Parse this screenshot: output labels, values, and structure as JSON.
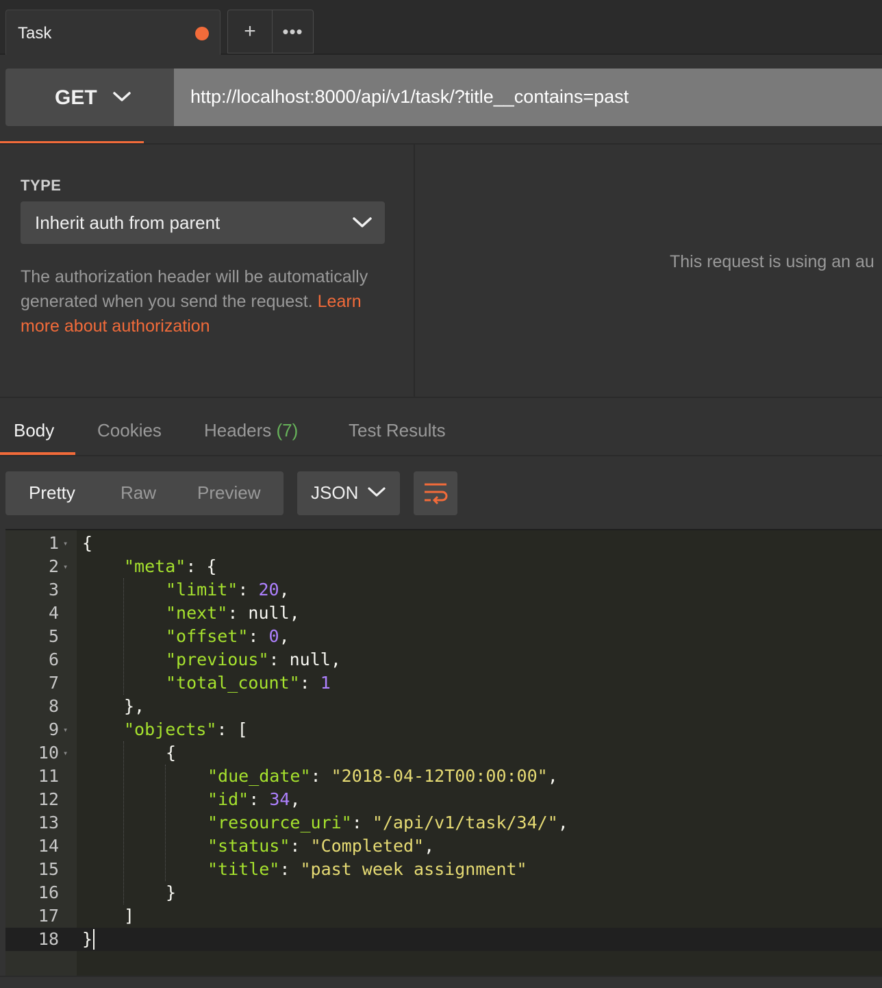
{
  "tabs": {
    "active_tab": "Task",
    "new_tab": "+",
    "more": "•••"
  },
  "request": {
    "method": "GET",
    "url": "http://localhost:8000/api/v1/task/?title__contains=past"
  },
  "auth": {
    "type_label": "TYPE",
    "type_value": "Inherit auth from parent",
    "description": "The authorization header will be automatically generated when you send the request. ",
    "link_text": "Learn more about authorization",
    "right_text": "This request is using an au"
  },
  "response_tabs": {
    "body": "Body",
    "cookies": "Cookies",
    "headers": "Headers",
    "headers_count": "(7)",
    "test_results": "Test Results"
  },
  "body_toolbar": {
    "pretty": "Pretty",
    "raw": "Raw",
    "preview": "Preview",
    "format": "JSON"
  },
  "editor": {
    "line_numbers": [
      "1",
      "2",
      "3",
      "4",
      "5",
      "6",
      "7",
      "8",
      "9",
      "10",
      "11",
      "12",
      "13",
      "14",
      "15",
      "16",
      "17",
      "18"
    ],
    "active_line": 18,
    "lines": [
      {
        "indent": 0,
        "tokens": [
          [
            "p",
            "{"
          ]
        ]
      },
      {
        "indent": 1,
        "tokens": [
          [
            "k",
            "\"meta\""
          ],
          [
            "p",
            ": {"
          ]
        ]
      },
      {
        "indent": 2,
        "tokens": [
          [
            "k",
            "\"limit\""
          ],
          [
            "p",
            ": "
          ],
          [
            "n",
            "20"
          ],
          [
            "p",
            ","
          ]
        ]
      },
      {
        "indent": 2,
        "tokens": [
          [
            "k",
            "\"next\""
          ],
          [
            "p",
            ": null,"
          ]
        ]
      },
      {
        "indent": 2,
        "tokens": [
          [
            "k",
            "\"offset\""
          ],
          [
            "p",
            ": "
          ],
          [
            "n",
            "0"
          ],
          [
            "p",
            ","
          ]
        ]
      },
      {
        "indent": 2,
        "tokens": [
          [
            "k",
            "\"previous\""
          ],
          [
            "p",
            ": null,"
          ]
        ]
      },
      {
        "indent": 2,
        "tokens": [
          [
            "k",
            "\"total_count\""
          ],
          [
            "p",
            ": "
          ],
          [
            "n",
            "1"
          ]
        ]
      },
      {
        "indent": 1,
        "tokens": [
          [
            "p",
            "},"
          ]
        ]
      },
      {
        "indent": 1,
        "tokens": [
          [
            "k",
            "\"objects\""
          ],
          [
            "p",
            ": ["
          ]
        ]
      },
      {
        "indent": 2,
        "tokens": [
          [
            "p",
            "{"
          ]
        ]
      },
      {
        "indent": 3,
        "tokens": [
          [
            "k",
            "\"due_date\""
          ],
          [
            "p",
            ": "
          ],
          [
            "s",
            "\"2018-04-12T00:00:00\""
          ],
          [
            "p",
            ","
          ]
        ]
      },
      {
        "indent": 3,
        "tokens": [
          [
            "k",
            "\"id\""
          ],
          [
            "p",
            ": "
          ],
          [
            "n",
            "34"
          ],
          [
            "p",
            ","
          ]
        ]
      },
      {
        "indent": 3,
        "tokens": [
          [
            "k",
            "\"resource_uri\""
          ],
          [
            "p",
            ": "
          ],
          [
            "s",
            "\"/api/v1/task/34/\""
          ],
          [
            "p",
            ","
          ]
        ]
      },
      {
        "indent": 3,
        "tokens": [
          [
            "k",
            "\"status\""
          ],
          [
            "p",
            ": "
          ],
          [
            "s",
            "\"Completed\""
          ],
          [
            "p",
            ","
          ]
        ]
      },
      {
        "indent": 3,
        "tokens": [
          [
            "k",
            "\"title\""
          ],
          [
            "p",
            ": "
          ],
          [
            "s",
            "\"past week assignment\""
          ]
        ]
      },
      {
        "indent": 2,
        "tokens": [
          [
            "p",
            "}"
          ]
        ]
      },
      {
        "indent": 1,
        "tokens": [
          [
            "p",
            "]"
          ]
        ]
      },
      {
        "indent": 0,
        "tokens": [
          [
            "p",
            "}"
          ]
        ]
      }
    ],
    "foldable_lines": [
      1,
      2,
      9,
      10
    ]
  },
  "colors": {
    "accent": "#f26b3a",
    "json_key": "#a6e22e",
    "json_string": "#e6db74",
    "json_number": "#ae81ff",
    "headers_count": "#67b35a"
  }
}
